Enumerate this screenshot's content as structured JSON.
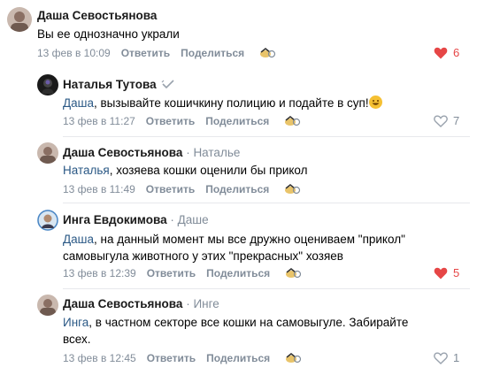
{
  "comments": [
    {
      "author": "Даша Севостьянова",
      "reply_to": "",
      "mention": "",
      "text": "Вы ее однозначно украли",
      "time": "13 фев в 10:09",
      "reply_label": "Ответить",
      "share_label": "Поделиться",
      "likes": "6",
      "liked": true
    },
    {
      "author": "Наталья Тутова",
      "reply_to": "",
      "mention": "Даша",
      "text": ", вызывайте кошичкину полицию и подайте в суп!",
      "time": "13 фев в 11:27",
      "reply_label": "Ответить",
      "share_label": "Поделиться",
      "likes": "7",
      "liked": false
    },
    {
      "author": "Даша Севостьянова",
      "reply_to": "Наталье",
      "mention": "Наталья",
      "text": ", хозяева кошки оценили бы прикол",
      "time": "13 фев в 11:49",
      "reply_label": "Ответить",
      "share_label": "Поделиться",
      "likes": "",
      "liked": false
    },
    {
      "author": "Инга Евдокимова",
      "reply_to": "Даше",
      "mention": "Даша",
      "text": ", на данный момент мы все дружно оцениваем \"прикол\" самовыгула животного у этих \"прекрасных\" хозяев",
      "time": "13 фев в 12:39",
      "reply_label": "Ответить",
      "share_label": "Поделиться",
      "likes": "5",
      "liked": true
    },
    {
      "author": "Даша Севостьянова",
      "reply_to": "Инге",
      "mention": "Инга",
      "text": ", в частном секторе все кошки на самовыгуле. Забирайте всех.",
      "time": "13 фев в 12:45",
      "reply_label": "Ответить",
      "share_label": "Поделиться",
      "likes": "1",
      "liked": false
    }
  ],
  "colors": {
    "link": "#2a5885",
    "meta": "#818c99",
    "like_active": "#e64646",
    "divider": "#e7e8ec"
  },
  "icons": [
    "heart-icon",
    "gift-icon",
    "verified-icon",
    "emoji-icon"
  ]
}
